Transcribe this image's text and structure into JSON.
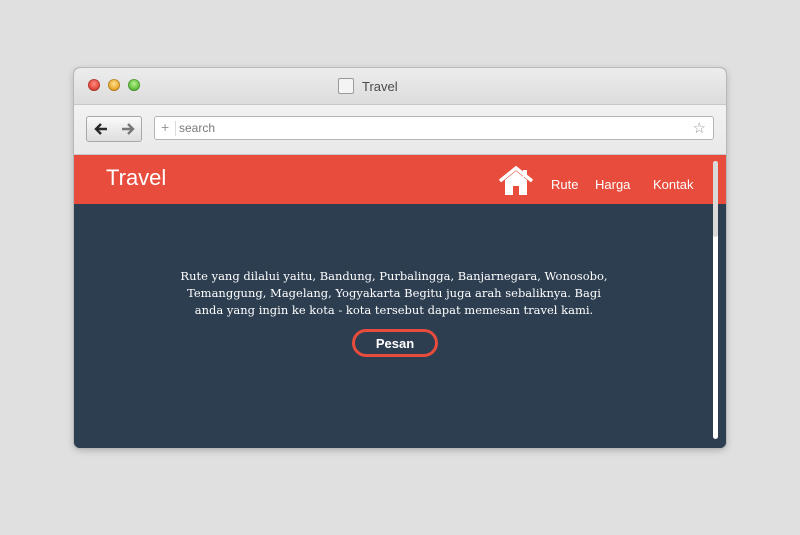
{
  "window": {
    "tab_title": "Travel"
  },
  "toolbar": {
    "back_icon": "arrow-left-icon",
    "forward_icon": "arrow-right-icon",
    "search_placeholder": "search",
    "plus_icon": "plus-icon",
    "star_icon": "star-icon"
  },
  "navbar": {
    "brand": "Travel",
    "home_icon": "home-icon",
    "links": [
      "Rute",
      "Harga",
      "Kontak"
    ]
  },
  "content": {
    "description": "Rute yang dilalui yaitu, Bandung, Purbalingga, Banjarnegara, Wonosobo, Temanggung, Magelang, Yogyakarta Begitu juga arah sebaliknya. Bagi anda yang ingin ke kota - kota tersebut dapat memesan travel kami.",
    "button_label": "Pesan"
  },
  "colors": {
    "accent": "#e74c3c",
    "background": "#2d3e50"
  }
}
